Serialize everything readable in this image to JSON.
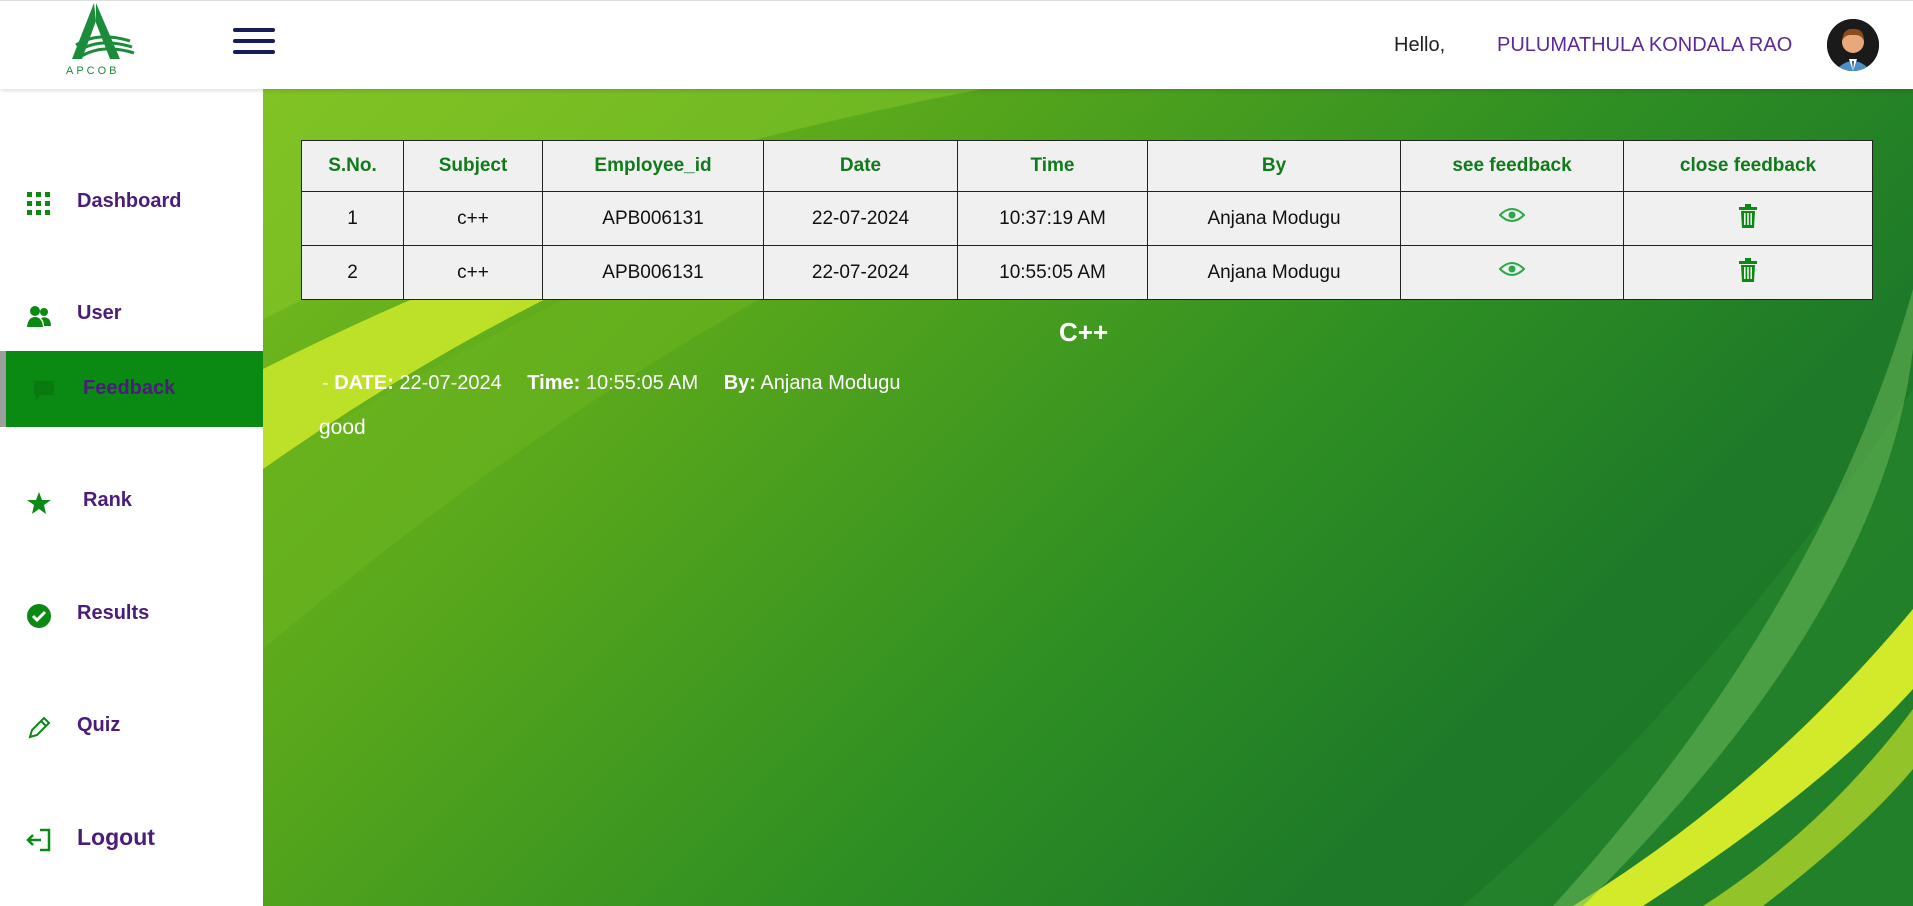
{
  "header": {
    "logo_text": "APCOB",
    "greeting": "Hello,",
    "user_name": "PULUMATHULA KONDALA RAO"
  },
  "sidebar": {
    "items": [
      {
        "label": "Dashboard",
        "icon": "grid-icon"
      },
      {
        "label": "User",
        "icon": "users-icon"
      },
      {
        "label": "Feedback",
        "icon": "feedback-icon",
        "active": true
      },
      {
        "label": "Rank",
        "icon": "star-icon"
      },
      {
        "label": "Results",
        "icon": "check-circle-icon"
      },
      {
        "label": "Quiz",
        "icon": "pencil-icon"
      },
      {
        "label": "Logout",
        "icon": "logout-icon"
      }
    ]
  },
  "table": {
    "headers": [
      "S.No.",
      "Subject",
      "Employee_id",
      "Date",
      "Time",
      "By",
      "see feedback",
      "close feedback"
    ],
    "rows": [
      {
        "sno": "1",
        "subject": "c++",
        "employee_id": "APB006131",
        "date": "22-07-2024",
        "time": "10:37:19 AM",
        "by": "Anjana Modugu"
      },
      {
        "sno": "2",
        "subject": "c++",
        "employee_id": "APB006131",
        "date": "22-07-2024",
        "time": "10:55:05 AM",
        "by": "Anjana Modugu"
      }
    ]
  },
  "detail": {
    "title": "C++",
    "prefix": "-",
    "date_label": "DATE:",
    "date": "22-07-2024",
    "time_label": "Time:",
    "time": "10:55:05 AM",
    "by_label": "By:",
    "by": "Anjana Modugu",
    "comment": "good"
  },
  "colors": {
    "accent_purple": "#4a1d7a",
    "active_green": "#0b8a13",
    "header_green": "#117a1a"
  }
}
